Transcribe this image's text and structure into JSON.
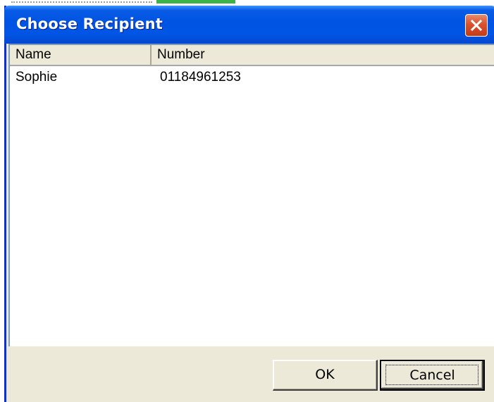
{
  "dialog": {
    "title": "Choose Recipient",
    "close_icon": "close-icon"
  },
  "list": {
    "columns": [
      "Name",
      "Number"
    ],
    "rows": [
      {
        "name": "Sophie",
        "number": "01184961253"
      }
    ]
  },
  "buttons": {
    "ok_label": "OK",
    "cancel_label": "Cancel"
  },
  "colors": {
    "titlebar": "#0054e3",
    "window_face": "#ece9d8",
    "close_button": "#d9512e",
    "list_border": "#7f9db9",
    "behind_highlight": "#3bb54a"
  }
}
